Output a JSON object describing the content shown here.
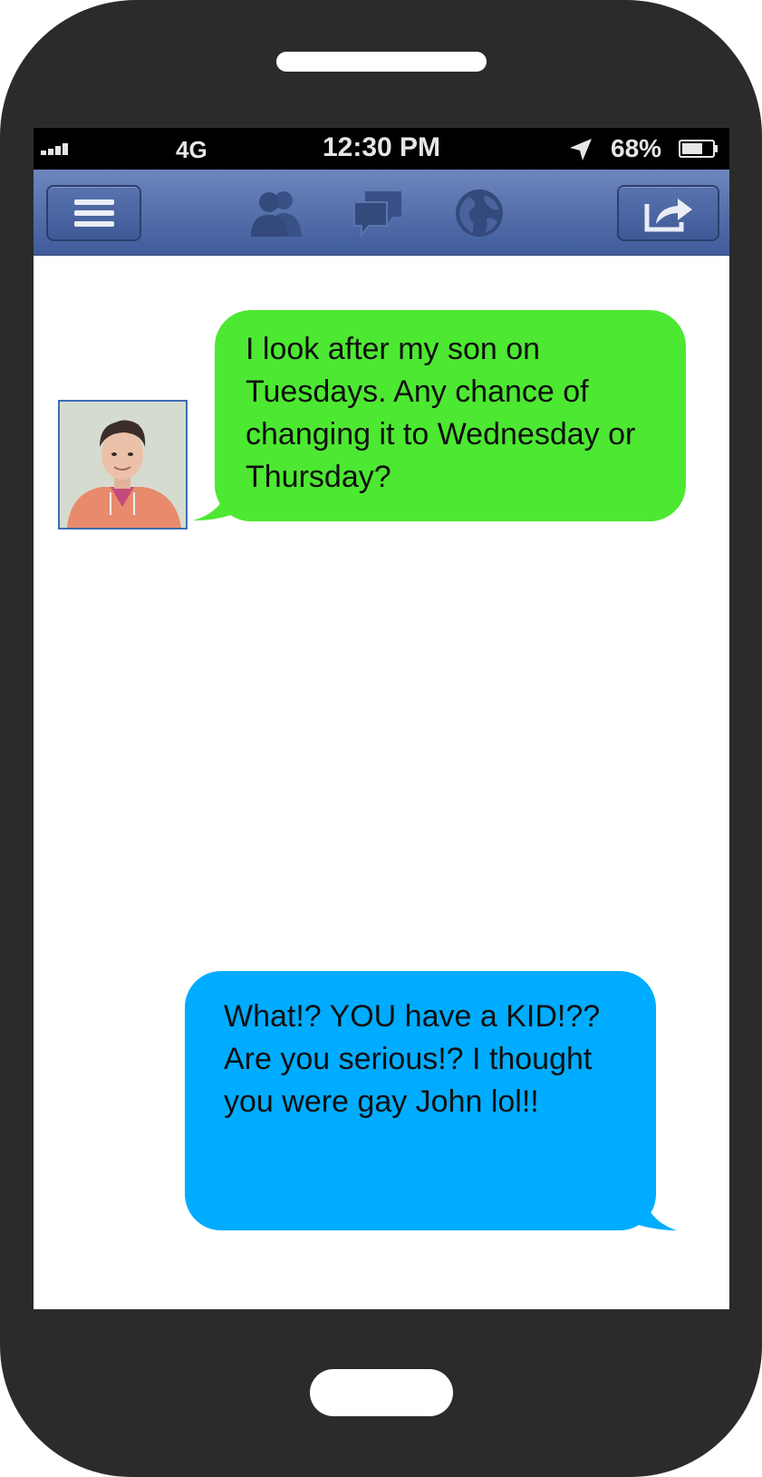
{
  "status_bar": {
    "carrier": "4G",
    "time": "12:30 PM",
    "battery": "68%",
    "signal_bars": 4
  },
  "nav": {
    "icons": [
      "menu-icon",
      "friends-icon",
      "messages-icon",
      "globe-icon",
      "share-icon"
    ]
  },
  "messages": [
    {
      "direction": "incoming",
      "text": "I look after my son on Tuesdays. Any chance of changing it to Wednesday or Thursday?"
    },
    {
      "direction": "outgoing",
      "text": "What!? YOU have a KID!?? Are you serious!? I thought you were gay John lol!!"
    }
  ],
  "colors": {
    "phone_body": "#2b2b2b",
    "nav_bar": "#4d69a8",
    "incoming_bubble": "#4de832",
    "outgoing_bubble": "#00acff"
  }
}
